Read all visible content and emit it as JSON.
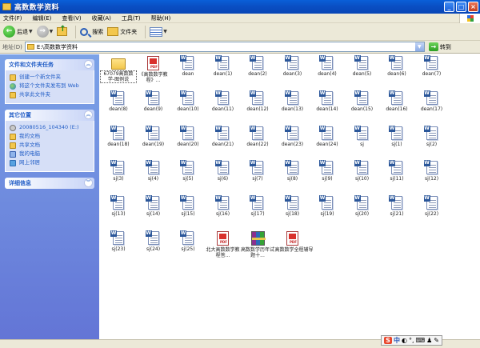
{
  "window": {
    "title": "高数数学资料"
  },
  "menu": [
    "文件(F)",
    "编辑(E)",
    "查看(V)",
    "收藏(A)",
    "工具(T)",
    "帮助(H)"
  ],
  "toolbar": {
    "back": "后退",
    "search": "搜索",
    "folders": "文件夹"
  },
  "address": {
    "label": "地址(D)",
    "path": "E:\\高数数学资料",
    "go": "转到"
  },
  "tasks": {
    "file_tasks": {
      "title": "文件和文件夹任务",
      "items": [
        "创建一个新文件夹",
        "将这个文件夹发布到 Web",
        "共享此文件夹"
      ]
    },
    "other_places": {
      "title": "其它位置",
      "items": [
        "20080516_104340 (E:)",
        "我的文档",
        "共享文档",
        "我的电脑",
        "网上邻居"
      ]
    },
    "details": {
      "title": "详细信息"
    }
  },
  "files": [
    {
      "name": "67079高数数学-图例说",
      "type": "folder"
    },
    {
      "name": "《高数数学教程》...",
      "type": "pdf"
    },
    {
      "name": "dean",
      "type": "word"
    },
    {
      "name": "dean(1)",
      "type": "word"
    },
    {
      "name": "dean(2)",
      "type": "word"
    },
    {
      "name": "dean(3)",
      "type": "word"
    },
    {
      "name": "dean(4)",
      "type": "word"
    },
    {
      "name": "dean(5)",
      "type": "word"
    },
    {
      "name": "dean(6)",
      "type": "word"
    },
    {
      "name": "dean(7)",
      "type": "word"
    },
    {
      "name": "dean(8)",
      "type": "word"
    },
    {
      "name": "dean(9)",
      "type": "word"
    },
    {
      "name": "dean(10)",
      "type": "word"
    },
    {
      "name": "dean(11)",
      "type": "word"
    },
    {
      "name": "dean(12)",
      "type": "word"
    },
    {
      "name": "dean(13)",
      "type": "word"
    },
    {
      "name": "dean(14)",
      "type": "word"
    },
    {
      "name": "dean(15)",
      "type": "word"
    },
    {
      "name": "dean(16)",
      "type": "word"
    },
    {
      "name": "dean(17)",
      "type": "word"
    },
    {
      "name": "dean(18)",
      "type": "word"
    },
    {
      "name": "dean(19)",
      "type": "word"
    },
    {
      "name": "dean(20)",
      "type": "word"
    },
    {
      "name": "dean(21)",
      "type": "word"
    },
    {
      "name": "dean(22)",
      "type": "word"
    },
    {
      "name": "dean(23)",
      "type": "word"
    },
    {
      "name": "dean(24)",
      "type": "word"
    },
    {
      "name": "sj",
      "type": "word"
    },
    {
      "name": "sj(1)",
      "type": "word"
    },
    {
      "name": "sj(2)",
      "type": "word"
    },
    {
      "name": "sj(3)",
      "type": "word"
    },
    {
      "name": "sj(4)",
      "type": "word"
    },
    {
      "name": "sj(5)",
      "type": "word"
    },
    {
      "name": "sj(6)",
      "type": "word"
    },
    {
      "name": "sj(7)",
      "type": "word"
    },
    {
      "name": "sj(8)",
      "type": "word"
    },
    {
      "name": "sj(9)",
      "type": "word"
    },
    {
      "name": "sj(10)",
      "type": "word"
    },
    {
      "name": "sj(11)",
      "type": "word"
    },
    {
      "name": "sj(12)",
      "type": "word"
    },
    {
      "name": "sj(13)",
      "type": "word"
    },
    {
      "name": "sj(14)",
      "type": "word"
    },
    {
      "name": "sj(15)",
      "type": "word"
    },
    {
      "name": "sj(16)",
      "type": "word"
    },
    {
      "name": "sj(17)",
      "type": "word"
    },
    {
      "name": "sj(18)",
      "type": "word"
    },
    {
      "name": "sj(19)",
      "type": "word"
    },
    {
      "name": "sj(20)",
      "type": "word"
    },
    {
      "name": "sj(21)",
      "type": "word"
    },
    {
      "name": "sj(22)",
      "type": "word"
    },
    {
      "name": "sj(23)",
      "type": "word"
    },
    {
      "name": "sj(24)",
      "type": "word"
    },
    {
      "name": "sj(25)",
      "type": "word"
    },
    {
      "name": "北大高数数学教程答...",
      "type": "pdf"
    },
    {
      "name": "高数数学历年试题十...",
      "type": "rar"
    },
    {
      "name": "高数数学全程辅导",
      "type": "pdf"
    }
  ],
  "ime": {
    "s": "S",
    "zh": "中"
  }
}
